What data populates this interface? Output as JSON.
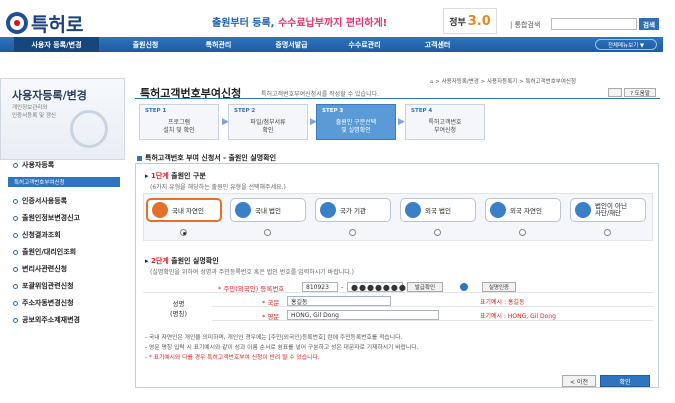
{
  "header": {
    "logo_text": "특허로",
    "slogan_part1": "출원부터 등록, ",
    "slogan_part2": "수수료납부까지 편리하게!",
    "gov_logo": {
      "small": "정부",
      "big": "3.0"
    },
    "search_label": "| 통합검색",
    "search_placeholder": "",
    "search_button": "검색"
  },
  "nav": {
    "items": [
      "사용자 등록/변경",
      "출원신청",
      "특허관리",
      "증명서발급",
      "수수료관리",
      "고객센터"
    ],
    "all_menu": "전체메뉴보기 ▼"
  },
  "sidebar": {
    "title": "사용자등록/변경",
    "subtitle": "개인정보관리와\n인증서등록 및 갱신",
    "items": [
      "사용자등록",
      "특허고객번호부여신청",
      "인증서사용등록",
      "출원인정보변경신고",
      "신청결과조회",
      "출원인/대리인조회",
      "변리사관련신청",
      "포괄위임관련신청",
      "주소자동변경신청",
      "공보외주소제재변경"
    ]
  },
  "main": {
    "title": "특허고객번호부여신청",
    "desc": "특허고객번호부여신청서를 작성할 수 있습니다.",
    "breadcrumb": "⌂ > 사용자등록/변경 > 사용자등록기 > 특허고객번호부여신청",
    "help": "? 도움말",
    "steps": [
      {
        "num": "STEP 1",
        "label": "프로그램\n설치 및 확인"
      },
      {
        "num": "STEP 2",
        "label": "파일/첨부서류\n확인"
      },
      {
        "num": "STEP 3",
        "label": "출원인 구분선택\n및 실명확인"
      },
      {
        "num": "STEP 4",
        "label": "특허고객번호\n부여신청"
      }
    ],
    "section_title": "특허고객번호 부여 신청서 - 출원인 실명확인",
    "step1": {
      "head_red": "1단계",
      "head": " 출원인 구분",
      "desc": "(6가지 유형을 해당하는 출원인 유형을 선택해주세요.)",
      "types": [
        "국내 자연인",
        "국내 법인",
        "국가 기관",
        "외국 법인",
        "외국 자연인",
        "법인이 아닌\n사단/재단"
      ]
    },
    "step2": {
      "head_red": "2단계",
      "head": " 출원인 실명확인",
      "desc": "(실명확인을 위하여 성명과 주민등록번호 혹은 법인 번호를 입력하시기 바랍니다.)",
      "rrn_label": "* 주민(외국인) 등록번호",
      "rrn_front": "810923",
      "rrn_dash": "-",
      "rrn_back": "●●●●●●●",
      "verify_btn": "발급확인",
      "realname_btn": "실명인증",
      "name_label": "성명\n(명칭)",
      "kor_label": "* 국문",
      "kor_value": "홍길동",
      "kor_example": "표기예시 : 홍길동",
      "eng_label": "* 영문",
      "eng_value": "HONG, Gil Dong",
      "eng_example": "표기예시 : HONG, Gil Dong"
    },
    "notes": [
      "- 국내 자연인은 개인을 의미하며, 개인인 경우에는 [주민(외국인)등록번호] 란에 주민등록번호를 적습니다.",
      "- 영문 명칭 입력 시 표기예시와 같이 성과 이름 순서로 쉼표를 넣어 구분하고 성은 대문자로 기재하시기 바랍니다.",
      "- * 표기예시와 다를 경우 특허고객번호부여 신청이 반려 될 수 있습니다."
    ],
    "prev_button": "< 이전",
    "next_button": "확인"
  }
}
